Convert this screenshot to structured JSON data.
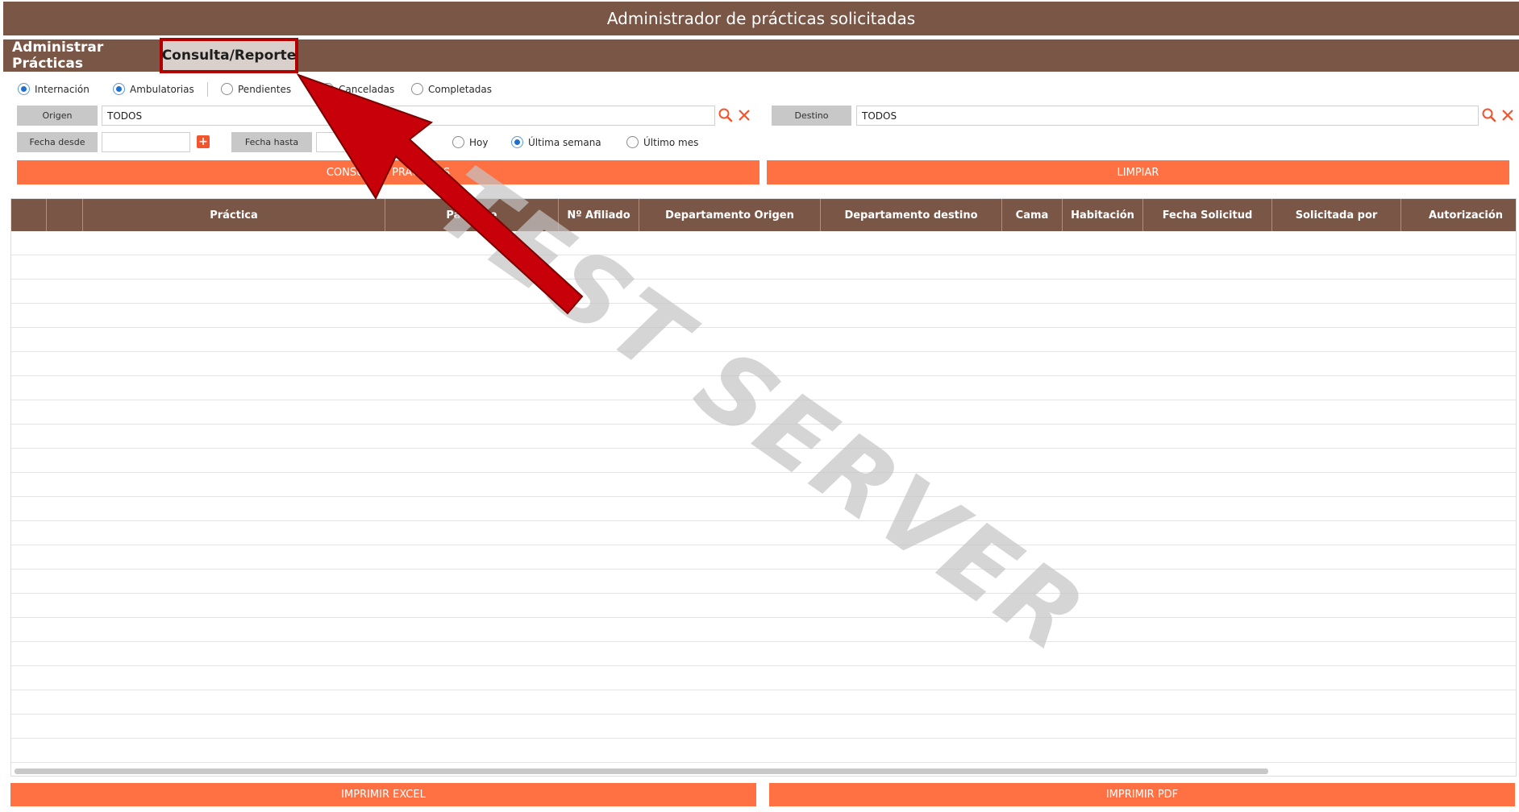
{
  "header": {
    "title": "Administrador de prácticas solicitadas"
  },
  "tabs": [
    {
      "label": "Administrar Prácticas",
      "active": false
    },
    {
      "label": "Consulta/Reporte",
      "active": true
    }
  ],
  "filters": {
    "type_radios": [
      {
        "label": "Internación",
        "checked": true
      },
      {
        "label": "Ambulatorias",
        "checked": true
      }
    ],
    "status_radios": [
      {
        "label": "Pendientes",
        "checked": false
      },
      {
        "label": "Canceladas",
        "checked": false
      },
      {
        "label": "Completadas",
        "checked": false
      }
    ],
    "origen": {
      "label": "Origen",
      "value": "TODOS"
    },
    "destino": {
      "label": "Destino",
      "value": "TODOS"
    },
    "fecha_desde": {
      "label": "Fecha desde",
      "value": ""
    },
    "fecha_hasta": {
      "label": "Fecha hasta",
      "value": ""
    },
    "period_radios": [
      {
        "label": "Hoy",
        "checked": false
      },
      {
        "label": "Última semana",
        "checked": true
      },
      {
        "label": "Último mes",
        "checked": false
      }
    ],
    "consultar_label": "CONSULTAR PRÁCTICAS",
    "limpiar_label": "LIMPIAR"
  },
  "table": {
    "columns": [
      "",
      "",
      "Práctica",
      "Paciente",
      "Nº Afiliado",
      "Departamento Origen",
      "Departamento destino",
      "Cama",
      "Habitación",
      "Fecha Solicitud",
      "Solicitada por",
      "Autorización"
    ],
    "rows": []
  },
  "footer": {
    "excel_label": "IMPRIMIR EXCEL",
    "pdf_label": "IMPRIMIR PDF"
  },
  "watermark": "TEST SERVER",
  "colors": {
    "brand_brown": "#7a5646",
    "accent_orange": "#ff7043",
    "icon_orange": "#f2542d",
    "highlight_red": "#b00000",
    "arrow_red": "#c8000a"
  }
}
